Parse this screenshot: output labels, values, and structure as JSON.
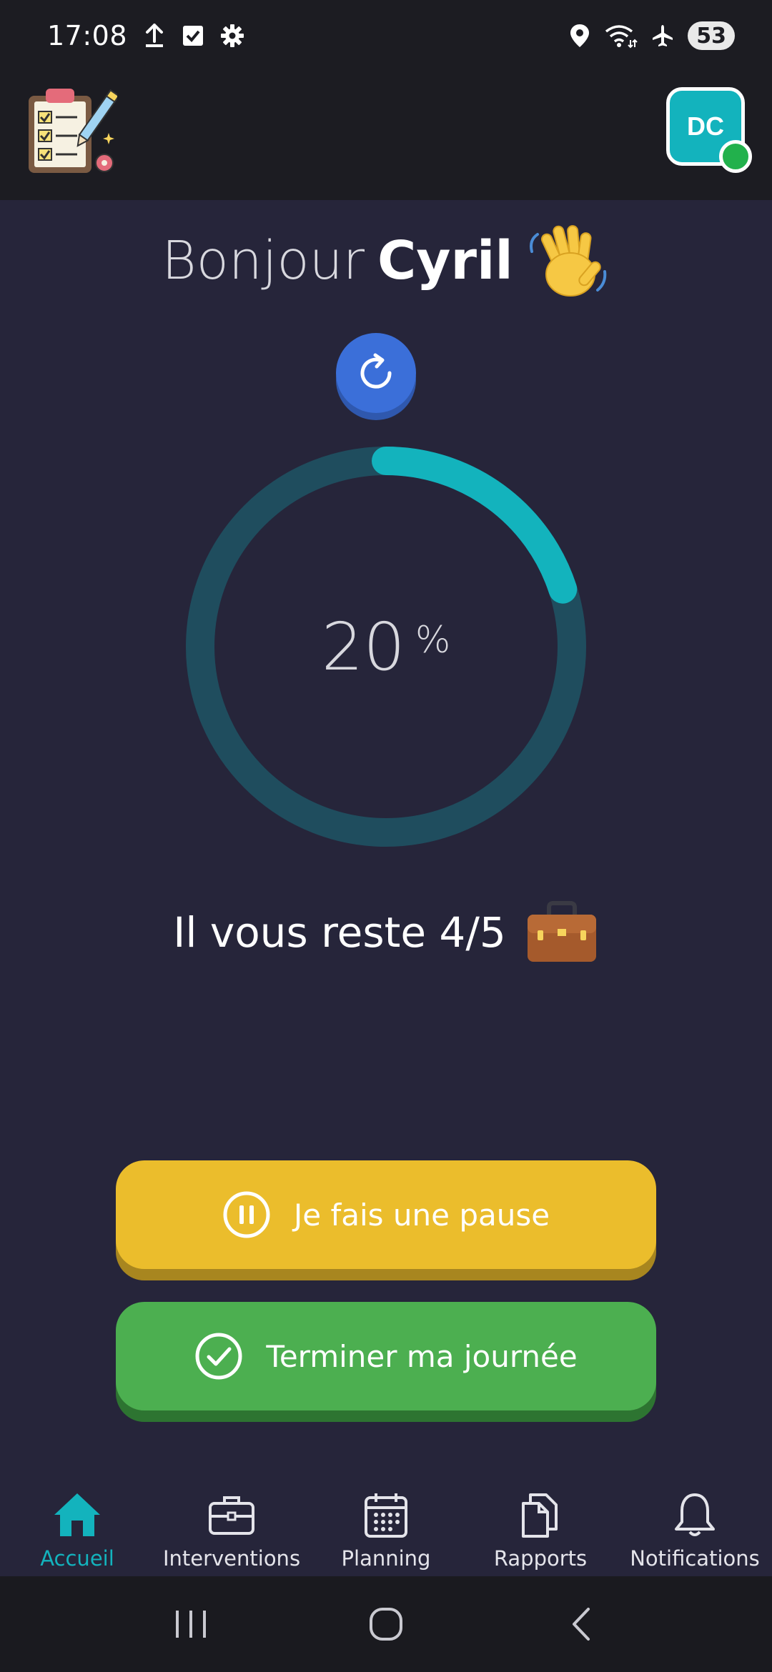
{
  "status_bar": {
    "time": "17:08",
    "battery": "53",
    "icons": [
      "upload-icon",
      "checkbox-icon",
      "settings-icon",
      "location-icon",
      "wifi-icon",
      "airplane-icon"
    ]
  },
  "header": {
    "logo_icon": "clipboard-checklist-icon",
    "avatar_initials": "DC",
    "avatar_color": "#13b3bd",
    "online_status_color": "#22b14c"
  },
  "greeting": {
    "prefix": "Bonjour",
    "name": "Cyril",
    "emoji": "waving-hand-icon"
  },
  "refresh": {
    "icon": "refresh-icon"
  },
  "progress": {
    "value": "20",
    "unit": "%",
    "fraction": 0.2,
    "track_color": "#1f4d5e",
    "fill_color": "#13b3bd"
  },
  "remaining": {
    "text": "Il vous reste 4/5",
    "emoji": "briefcase-icon"
  },
  "actions": {
    "pause_label": "Je fais une pause",
    "pause_color": "#ebbd2c",
    "finish_label": "Terminer ma journée",
    "finish_color": "#4caf50"
  },
  "bottom_nav": {
    "active": "Accueil",
    "active_color": "#13b3bd",
    "items": [
      {
        "label": "Accueil",
        "icon": "home-icon"
      },
      {
        "label": "Interventions",
        "icon": "briefcase-icon"
      },
      {
        "label": "Planning",
        "icon": "calendar-icon"
      },
      {
        "label": "Rapports",
        "icon": "documents-icon"
      },
      {
        "label": "Notifications",
        "icon": "bell-icon"
      }
    ]
  },
  "system_nav": {
    "icons": [
      "recent-apps-icon",
      "home-circle-icon",
      "back-icon"
    ]
  }
}
